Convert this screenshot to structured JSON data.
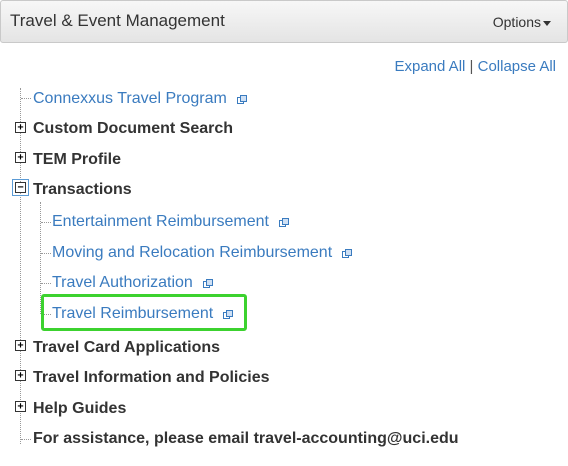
{
  "header": {
    "title": "Travel & Event Management",
    "options_label": "Options"
  },
  "toolbar": {
    "expand_all": "Expand All",
    "separator": "|",
    "collapse_all": "Collapse All"
  },
  "tree": {
    "connexxus": "Connexxus Travel Program",
    "custom_document_search": "Custom Document Search",
    "tem_profile": "TEM Profile",
    "transactions": "Transactions",
    "entertainment": "Entertainment Reimbursement",
    "moving": "Moving and Relocation Reimbursement",
    "travel_authorization": "Travel Authorization",
    "travel_reimbursement": "Travel Reimbursement",
    "travel_card": "Travel Card Applications",
    "travel_info": "Travel Information and Policies",
    "help_guides": "Help Guides",
    "assistance": "For assistance, please email travel-accounting@uci.edu"
  },
  "colors": {
    "link": "#3a7bbf",
    "highlight": "#3cd22f"
  }
}
